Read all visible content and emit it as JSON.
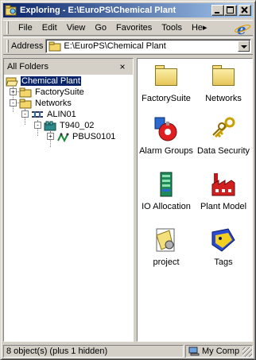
{
  "window": {
    "title": "Exploring - E:\\EuroPS\\Chemical Plant",
    "buttons": {
      "minimize": "_",
      "maximize": "□",
      "close": "×"
    }
  },
  "menubar": {
    "items": [
      "File",
      "Edit",
      "View",
      "Go",
      "Favorites",
      "Tools",
      "He▸"
    ]
  },
  "addressbar": {
    "label": "Address",
    "value": "E:\\EuroPS\\Chemical Plant"
  },
  "folderpane": {
    "header": "All Folders",
    "close": "×",
    "tree": [
      {
        "label": "Chemical Plant",
        "icon": "open-folder-icon",
        "selected": true,
        "expander": ""
      },
      {
        "label": "FactorySuite",
        "icon": "folder-icon",
        "selected": false,
        "expander": "+"
      },
      {
        "label": "Networks",
        "icon": "folder-icon",
        "selected": false,
        "expander": "-"
      },
      {
        "label": "ALIN01",
        "icon": "network-icon",
        "selected": false,
        "expander": "-"
      },
      {
        "label": "T940_02",
        "icon": "controller-icon",
        "selected": false,
        "expander": "-"
      },
      {
        "label": "PBUS0101",
        "icon": "bus-icon",
        "selected": false,
        "expander": "+"
      }
    ]
  },
  "contents": {
    "items": [
      {
        "label": "FactorySuite",
        "icon": "folder-icon"
      },
      {
        "label": "Networks",
        "icon": "folder-icon"
      },
      {
        "label": "Alarm Groups",
        "icon": "alarm-icon"
      },
      {
        "label": "Data Security",
        "icon": "keys-icon"
      },
      {
        "label": "IO Allocation",
        "icon": "io-module-icon"
      },
      {
        "label": "Plant Model",
        "icon": "factory-icon"
      },
      {
        "label": "project",
        "icon": "project-icon"
      },
      {
        "label": "Tags",
        "icon": "tags-icon"
      }
    ]
  },
  "statusbar": {
    "objects": "8 object(s) (plus 1 hidden)",
    "location": "My Comp"
  },
  "colors": {
    "title_gradient_start": "#0a246a",
    "title_gradient_end": "#a6caf0",
    "face": "#d4d0c8",
    "selection": "#0a246a"
  }
}
